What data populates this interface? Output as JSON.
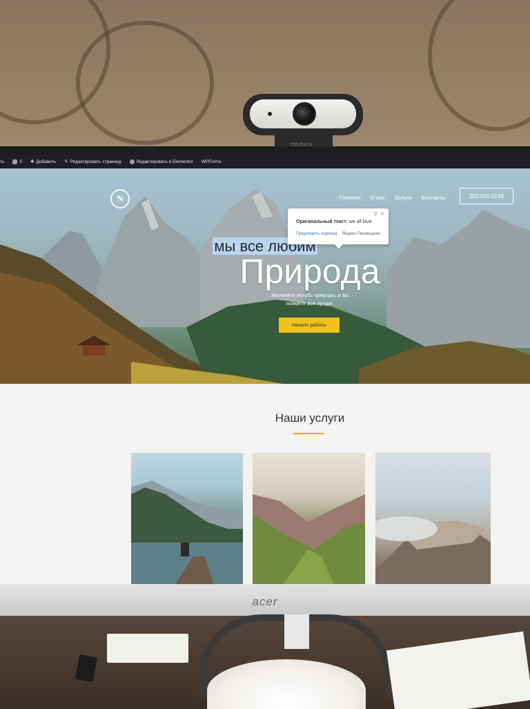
{
  "admin_bar": {
    "left_fragment": "ть",
    "comments_count": "0",
    "add": "Добавить",
    "edit_page": "Редактировать страницу",
    "edit_elementor": "Редактировать в Elementor",
    "wpforms": "WPForms"
  },
  "site": {
    "logo_letter": "N",
    "nav": [
      "Главная",
      "О нас",
      "Услуги",
      "Контакты"
    ],
    "phone": "202-555-0188"
  },
  "translate_tooltip": {
    "original_label": "Оригинальный текст:",
    "original_text": "we all love",
    "suggest": "Предложить перевод",
    "provider": "Яндекс.Переводчик"
  },
  "hero": {
    "subtitle": "мы все любим",
    "title": "Природа",
    "description": "Загляните вглубь природы, и вы поймете все лучше.",
    "cta": "Начало работы"
  },
  "services": {
    "title": "Наши услуги"
  },
  "hardware": {
    "webcam_brand": "rombica",
    "monitor_brand": "acer"
  },
  "colors": {
    "accent": "#f2c21b",
    "admin_bar": "#1e1f22",
    "underline": "#e0a82e"
  }
}
